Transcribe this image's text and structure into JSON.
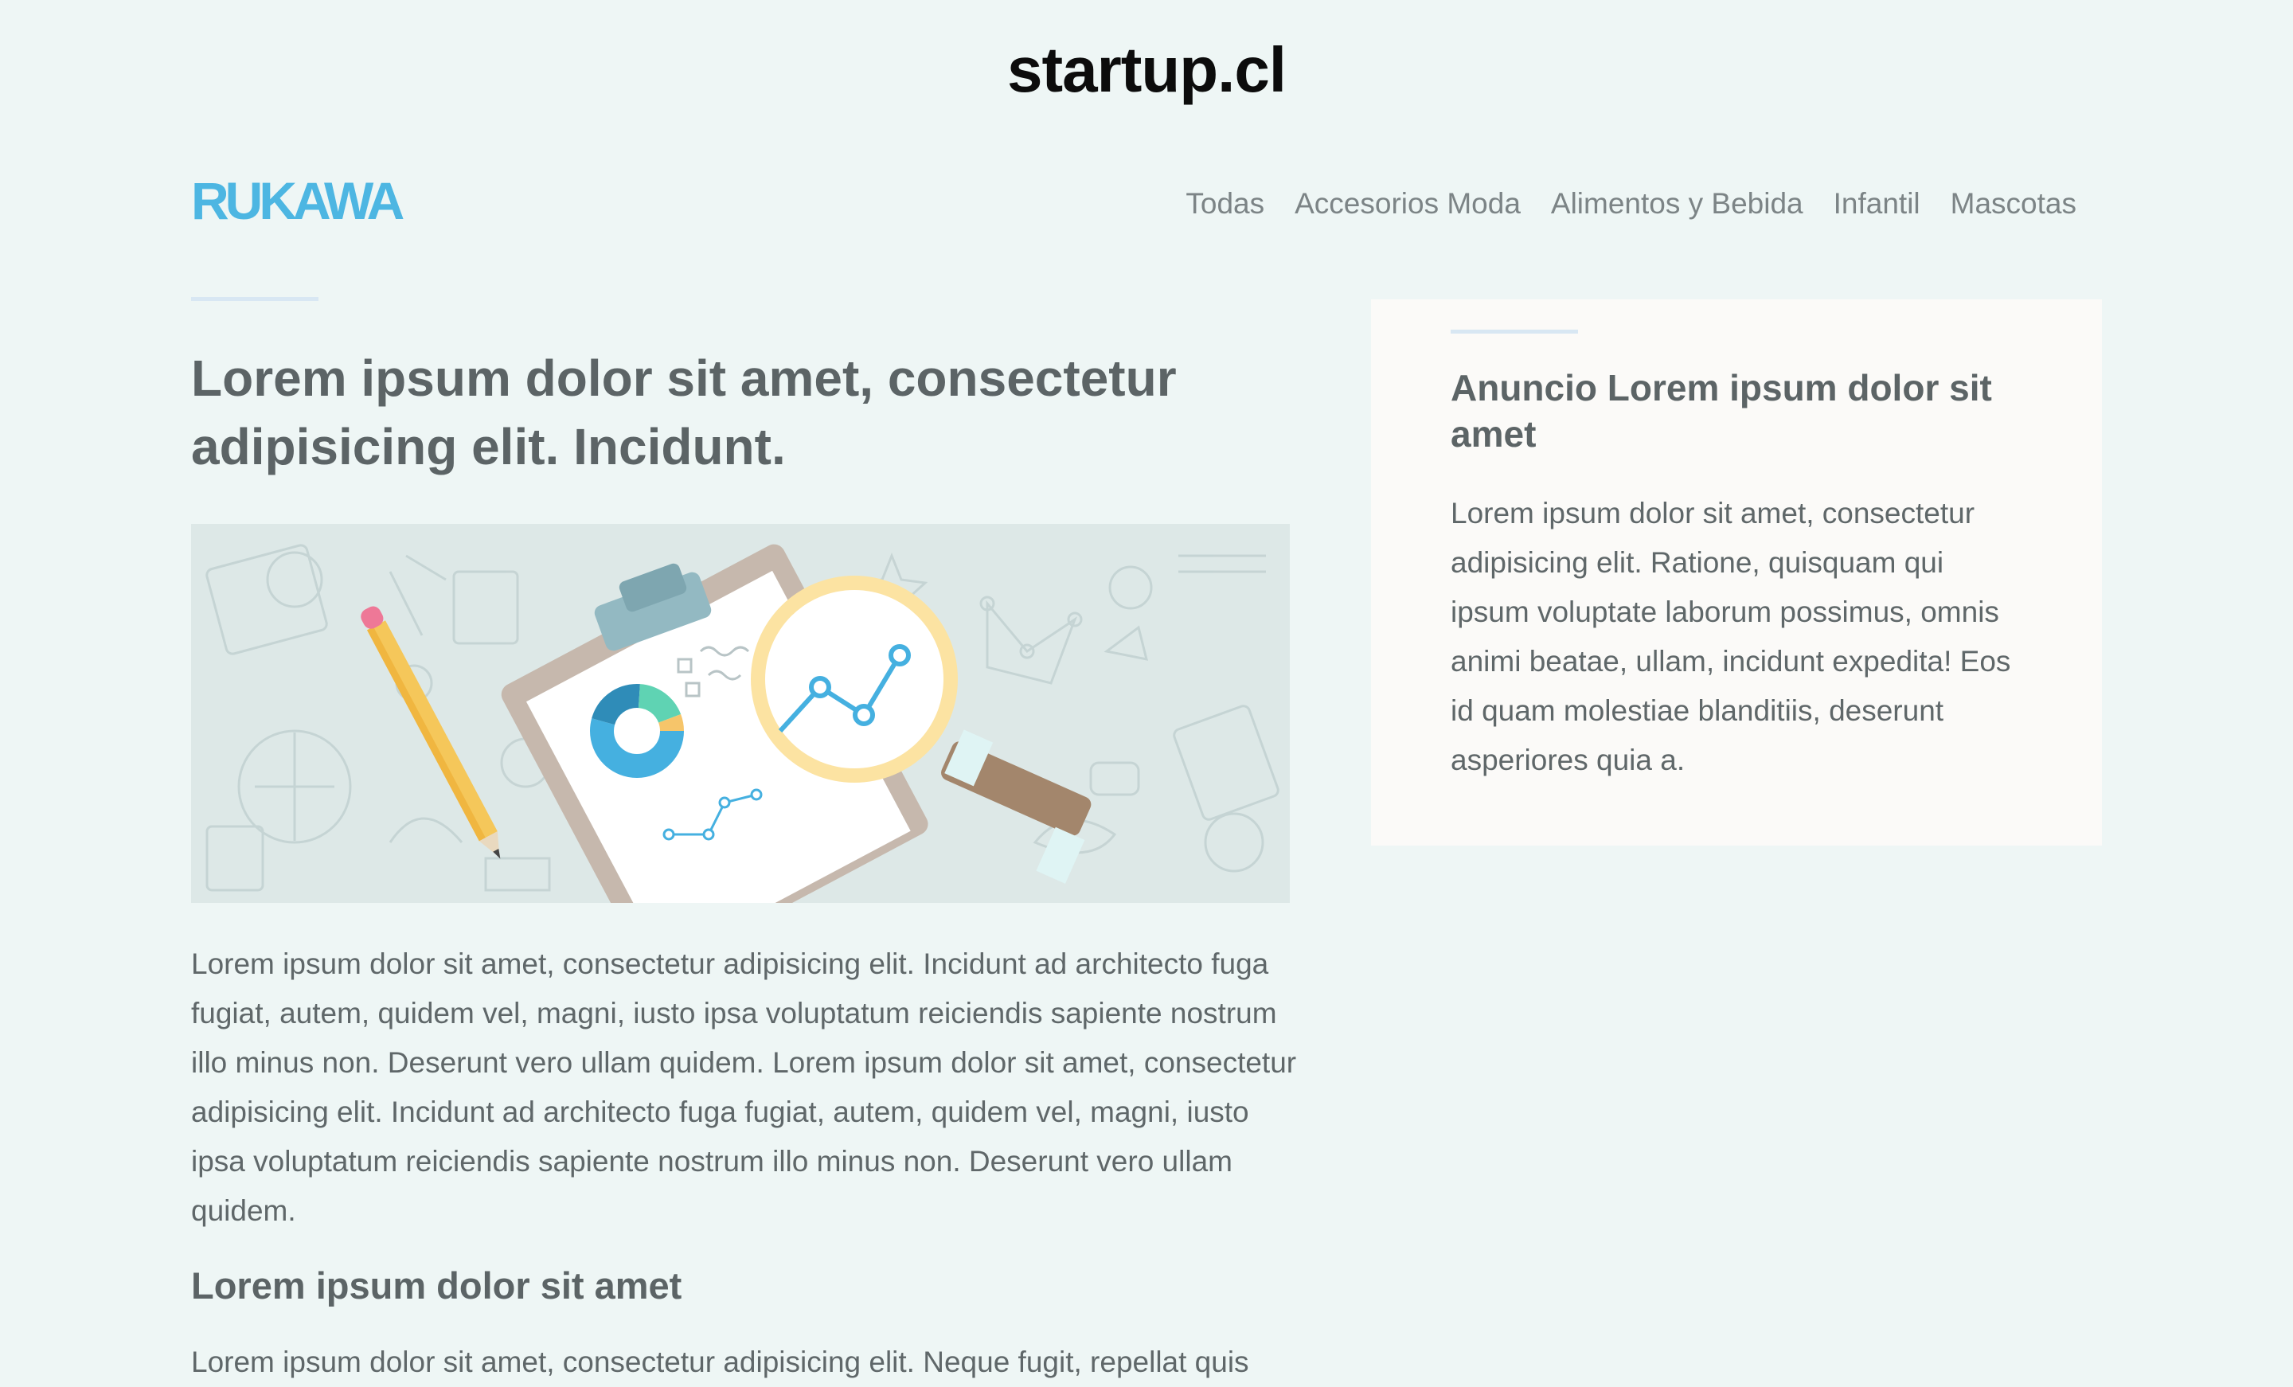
{
  "site": {
    "name": "startup.cl"
  },
  "header": {
    "logo": "RUKAWA",
    "nav": [
      {
        "label": "Todas"
      },
      {
        "label": "Accesorios Moda"
      },
      {
        "label": "Alimentos y Bebida"
      },
      {
        "label": "Infantil"
      },
      {
        "label": "Mascotas"
      }
    ]
  },
  "article": {
    "title": "Lorem ipsum dolor sit amet, consectetur adipisicing elit. Incidunt.",
    "paragraph1": "Lorem ipsum dolor sit amet, consectetur adipisicing elit. Incidunt ad architecto fuga fugiat, autem, quidem vel, magni, iusto ipsa voluptatum reiciendis sapiente nostrum illo minus non. Deserunt vero ullam quidem. Lorem ipsum dolor sit amet, consectetur adipisicing elit. Incidunt ad architecto fuga fugiat, autem, quidem vel, magni, iusto ipsa voluptatum reiciendis sapiente nostrum illo minus non. Deserunt vero ullam quidem.",
    "subheading": "Lorem ipsum dolor sit amet",
    "paragraph2": "Lorem ipsum dolor sit amet, consectetur adipisicing elit. Neque fugit, repellat quis"
  },
  "sidebar": {
    "ad_title": "Anuncio Lorem ipsum dolor sit amet",
    "ad_text": "Lorem ipsum dolor sit amet, consectetur adipisicing elit. Ratione, quisquam qui ipsum voluptate laborum possimus, omnis animi beatae, ullam, incidunt expedita! Eos id quam molestiae blanditiis, deserunt asperiores quia a."
  },
  "colors": {
    "background": "#eef6f5",
    "logo": "#4db6e2",
    "heading": "#5c6466",
    "body_text": "#5f6769",
    "nav_text": "#7c8486",
    "accent_rule": "#d8e7f3",
    "sidebar_bg": "#fbfaf8"
  },
  "hero_image": {
    "icons": [
      "pencil-icon",
      "clipboard-icon",
      "magnifying-glass-icon",
      "donut-chart-icon",
      "line-graph-icon"
    ]
  }
}
